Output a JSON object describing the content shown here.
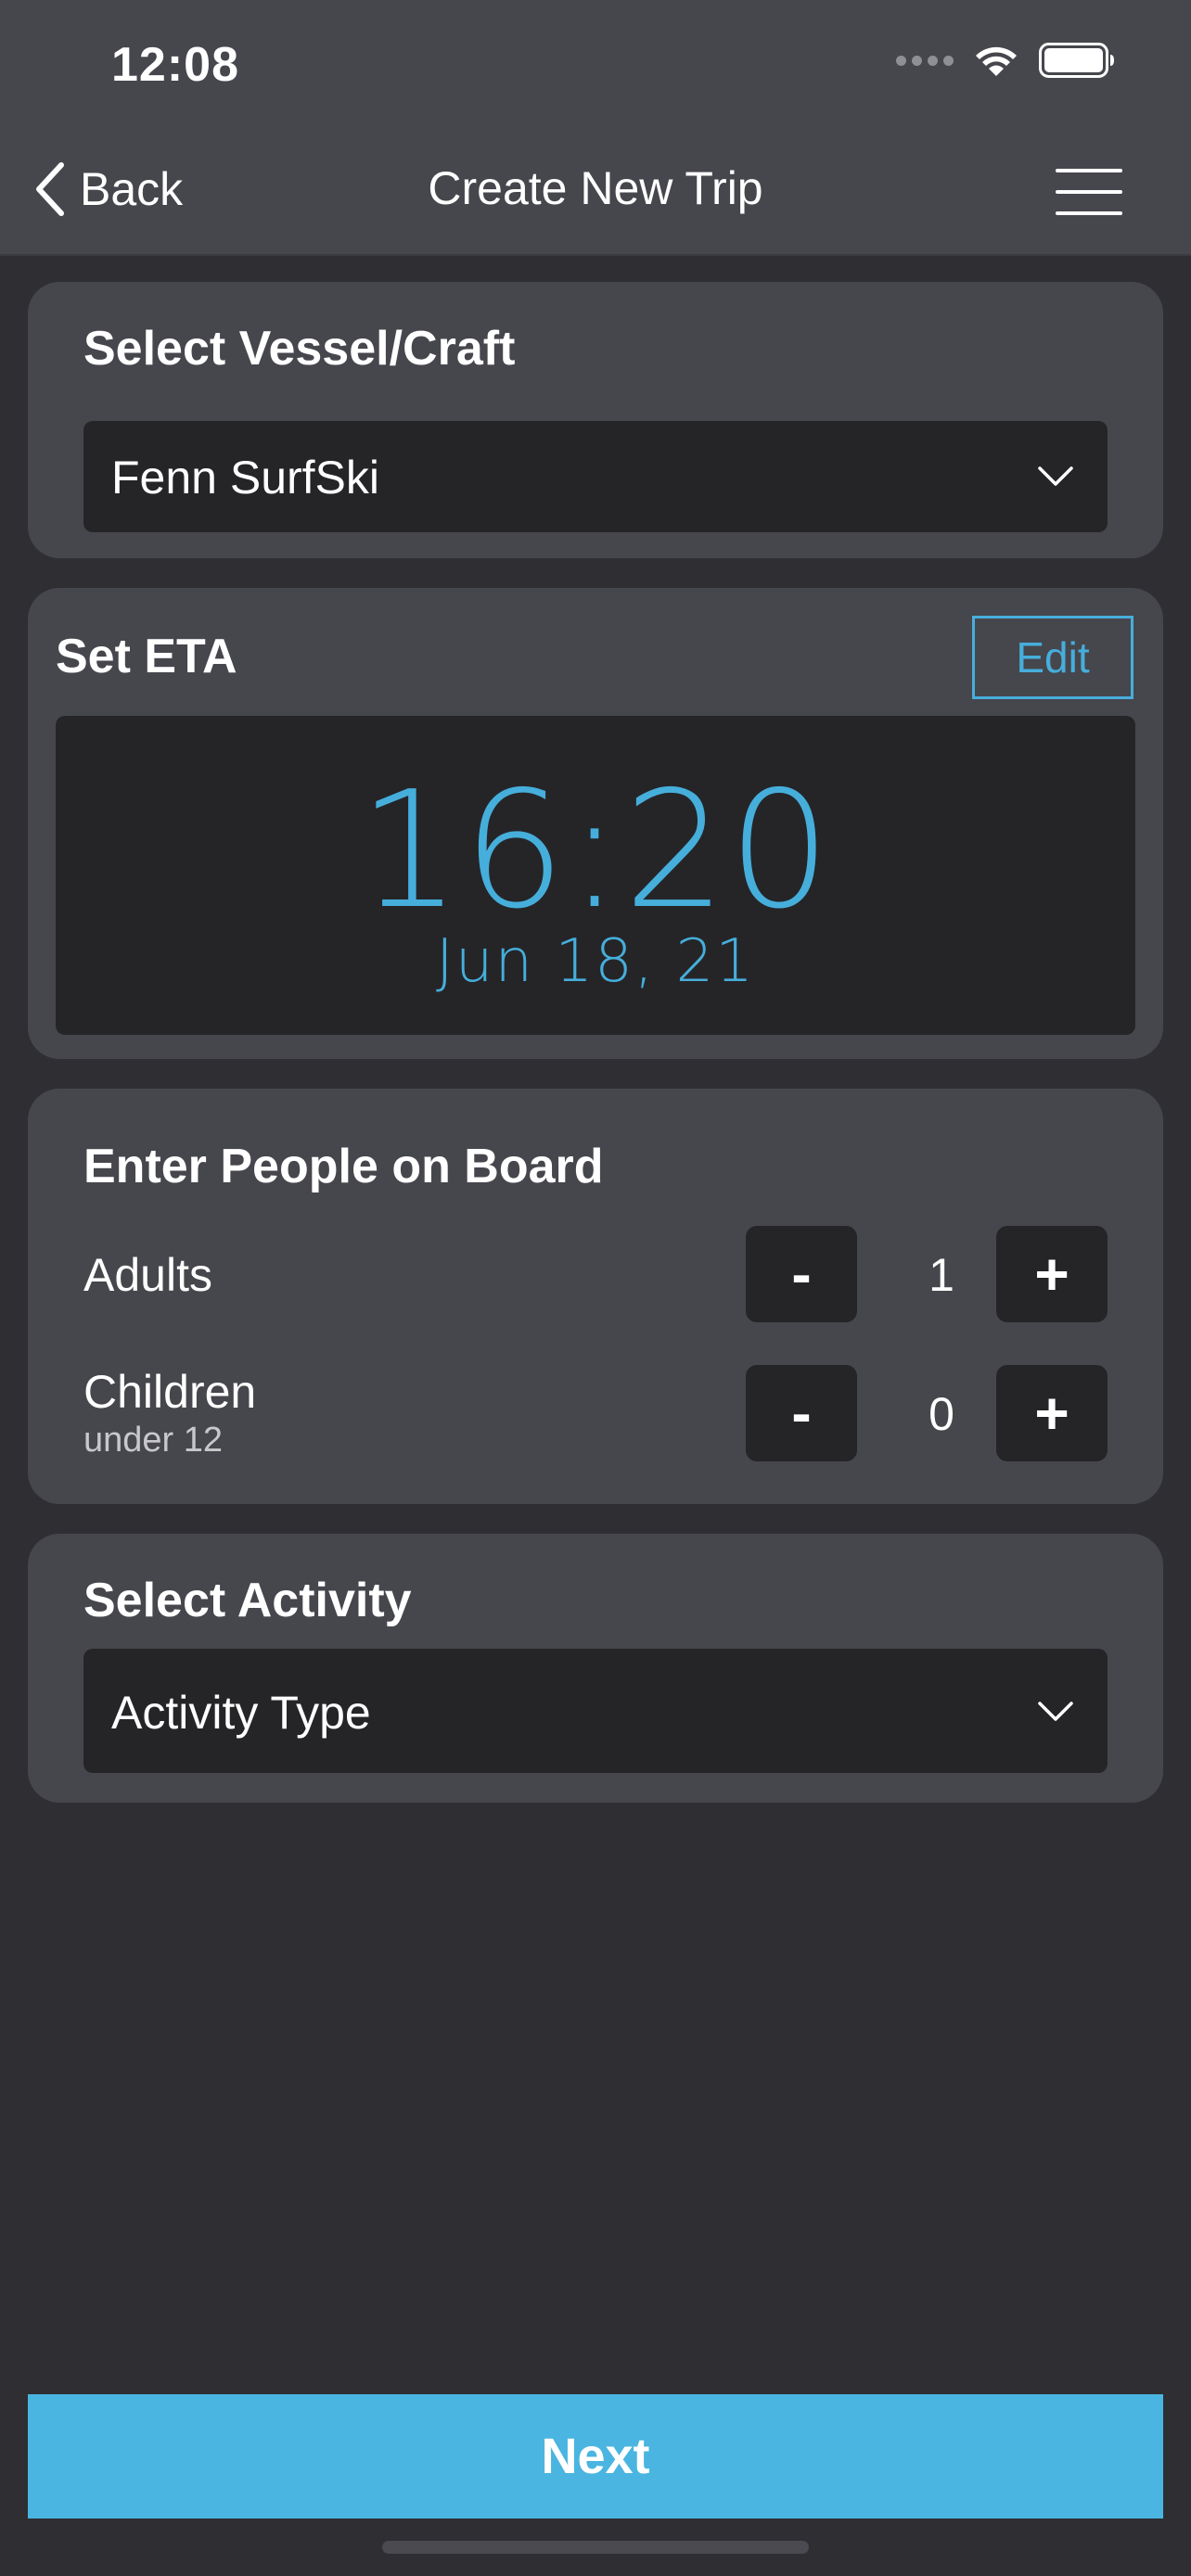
{
  "status_bar": {
    "time": "12:08",
    "icons": [
      "signal-dots-icon",
      "wifi-icon",
      "battery-icon"
    ]
  },
  "nav": {
    "back_label": "Back",
    "title": "Create New Trip",
    "menu_icon": "hamburger-menu-icon"
  },
  "vessel": {
    "title": "Select Vessel/Craft",
    "selected": "Fenn SurfSki"
  },
  "eta": {
    "title": "Set ETA",
    "edit_label": "Edit",
    "time": "16:20",
    "date": "Jun 18, 21"
  },
  "people": {
    "title": "Enter People on Board",
    "adults": {
      "label": "Adults",
      "value": "1",
      "minus": "-",
      "plus": "+"
    },
    "children": {
      "label": "Children",
      "sublabel": "under 12",
      "value": "0",
      "minus": "-",
      "plus": "+"
    }
  },
  "activity": {
    "title": "Select Activity",
    "placeholder": "Activity Type"
  },
  "footer": {
    "next_label": "Next"
  },
  "colors": {
    "accent": "#4ab5e0",
    "eta_text": "#46aedb",
    "background": "#2e2e33",
    "card": "#46464d",
    "field": "#252528"
  }
}
